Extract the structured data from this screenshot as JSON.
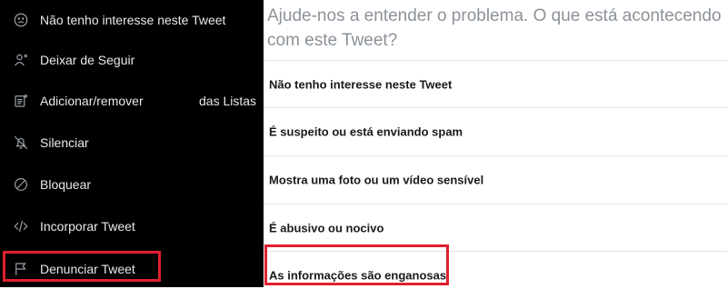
{
  "menu": {
    "items": [
      {
        "label": "Não tenho interesse neste Tweet",
        "icon": "sad-face-icon"
      },
      {
        "label": "Deixar de Seguir",
        "icon": "unfollow-user-icon"
      },
      {
        "label": "Adicionar/remover",
        "label_suffix": "das Listas",
        "icon": "list-add-icon"
      },
      {
        "label": "Silenciar",
        "icon": "mute-icon"
      },
      {
        "label": "Bloquear",
        "icon": "block-icon"
      },
      {
        "label": "Incorporar Tweet",
        "icon": "embed-code-icon"
      },
      {
        "label": "Denunciar Tweet",
        "icon": "flag-icon"
      }
    ]
  },
  "report": {
    "prompt": "Ajude-nos a entender o problema. O que está acontecendo com este Tweet?",
    "options": [
      "Não tenho interesse neste Tweet",
      "É suspeito ou está enviando spam",
      "Mostra uma foto ou um vídeo sensível",
      "É abusivo ou nocivo",
      "As informações são enganosas"
    ]
  },
  "colors": {
    "menu_background": "#000000",
    "highlight": "#e0202f",
    "prompt_text": "#8b9299"
  }
}
